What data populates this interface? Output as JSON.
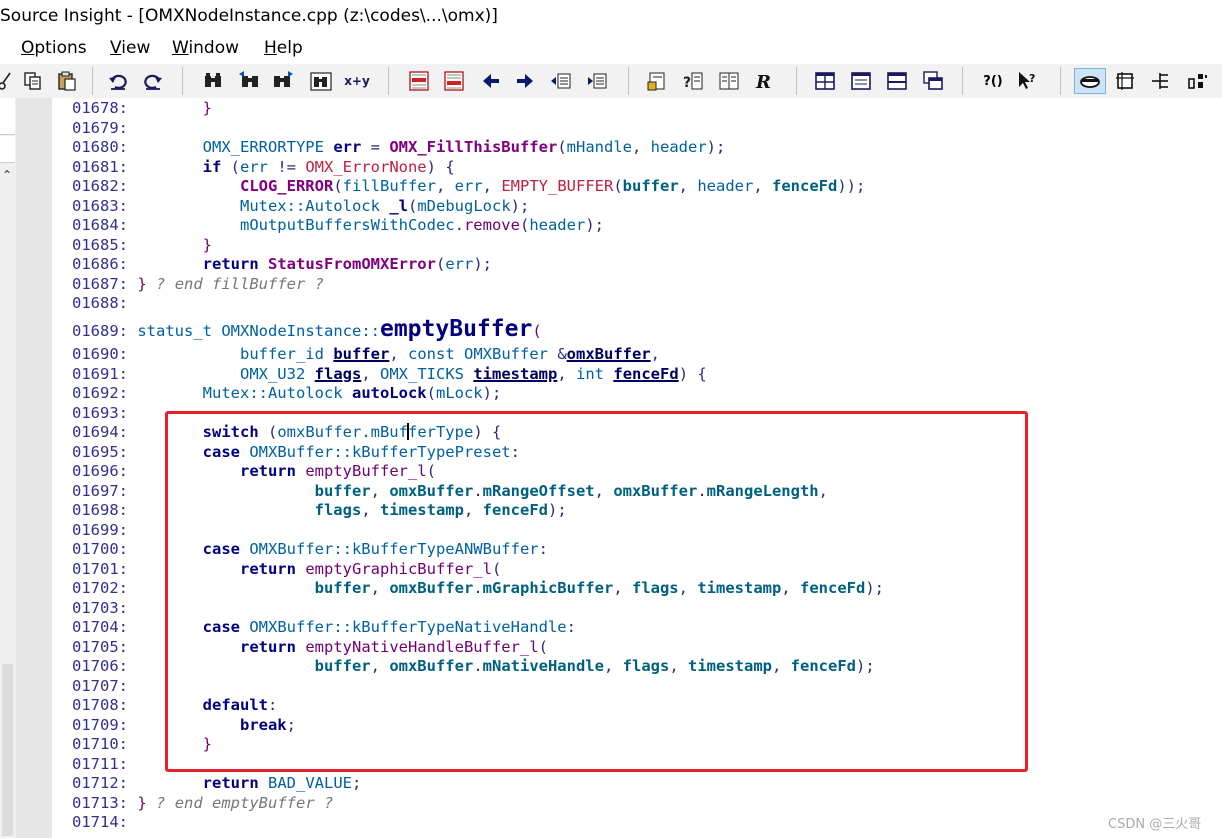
{
  "window": {
    "title": "Source Insight - [OMXNodeInstance.cpp (z:\\codes\\...\\omx)]"
  },
  "menu": [
    {
      "label": "Options",
      "u": "O",
      "rest": "ptions"
    },
    {
      "label": "View",
      "u": "V",
      "rest": "iew"
    },
    {
      "label": "Window",
      "u": "W",
      "rest": "indow"
    },
    {
      "label": "Help",
      "u": "H",
      "rest": "elp"
    }
  ],
  "toolbar": {
    "icons": [
      "cut-icon",
      "copy-icon",
      "paste-icon",
      "undo-icon",
      "redo-icon",
      "find-icon",
      "find-prev-icon",
      "find-next-icon",
      "search-files-icon",
      "replace-icon",
      "bookmark-prev-icon",
      "bookmark-next-icon",
      "back-icon",
      "forward-icon",
      "indent-right-icon",
      "indent-left-icon",
      "lookup-symbol-icon",
      "symbol-info-icon",
      "browse-book-icon",
      "relation-icon",
      "window-tile-icon",
      "window-list-icon",
      "window-split-icon",
      "window-cascade-icon",
      "context-help-icon",
      "pointer-help-icon",
      "toggle-view-icon",
      "layout-icon",
      "tree-icon",
      "grid-icon"
    ],
    "replace_label": "x+y",
    "help_label": "?()"
  },
  "code": {
    "lines": [
      {
        "n": "01678:",
        "html": "        }"
      },
      {
        "n": "01679:",
        "html": ""
      },
      {
        "n": "01680:",
        "html": "        OMX_ERRORTYPE err = OMX_FillThisBuffer(mHandle, header);"
      },
      {
        "n": "01681:",
        "html": "        if (err != OMX_ErrorNone) {"
      },
      {
        "n": "01682:",
        "html": "            CLOG_ERROR(fillBuffer, err, EMPTY_BUFFER(buffer, header, fenceFd));"
      },
      {
        "n": "01683:",
        "html": "            Mutex::Autolock _l(mDebugLock);"
      },
      {
        "n": "01684:",
        "html": "            mOutputBuffersWithCodec.remove(header);"
      },
      {
        "n": "01685:",
        "html": "        }"
      },
      {
        "n": "01686:",
        "html": "        return StatusFromOMXError(err);"
      },
      {
        "n": "01687:",
        "html": "} ? end fillBuffer ?"
      },
      {
        "n": "01688:",
        "html": ""
      },
      {
        "n": "01689:",
        "html": "status_t OMXNodeInstance::emptyBuffer("
      },
      {
        "n": "01690:",
        "html": "            buffer_id buffer, const OMXBuffer &omxBuffer,"
      },
      {
        "n": "01691:",
        "html": "            OMX_U32 flags, OMX_TICKS timestamp, int fenceFd) {"
      },
      {
        "n": "01692:",
        "html": "        Mutex::Autolock autoLock(mLock);"
      },
      {
        "n": "01693:",
        "html": ""
      },
      {
        "n": "01694:",
        "html": "        switch (omxBuffer.mBufferType) {"
      },
      {
        "n": "01695:",
        "html": "        case OMXBuffer::kBufferTypePreset:"
      },
      {
        "n": "01696:",
        "html": "            return emptyBuffer_l("
      },
      {
        "n": "01697:",
        "html": "                    buffer, omxBuffer.mRangeOffset, omxBuffer.mRangeLength,"
      },
      {
        "n": "01698:",
        "html": "                    flags, timestamp, fenceFd);"
      },
      {
        "n": "01699:",
        "html": ""
      },
      {
        "n": "01700:",
        "html": "        case OMXBuffer::kBufferTypeANWBuffer:"
      },
      {
        "n": "01701:",
        "html": "            return emptyGraphicBuffer_l("
      },
      {
        "n": "01702:",
        "html": "                    buffer, omxBuffer.mGraphicBuffer, flags, timestamp, fenceFd);"
      },
      {
        "n": "01703:",
        "html": ""
      },
      {
        "n": "01704:",
        "html": "        case OMXBuffer::kBufferTypeNativeHandle:"
      },
      {
        "n": "01705:",
        "html": "            return emptyNativeHandleBuffer_l("
      },
      {
        "n": "01706:",
        "html": "                    buffer, omxBuffer.mNativeHandle, flags, timestamp, fenceFd);"
      },
      {
        "n": "01707:",
        "html": ""
      },
      {
        "n": "01708:",
        "html": "        default:"
      },
      {
        "n": "01709:",
        "html": "            break;"
      },
      {
        "n": "01710:",
        "html": "        }"
      },
      {
        "n": "01711:",
        "html": ""
      },
      {
        "n": "01712:",
        "html": "        return BAD_VALUE;"
      },
      {
        "n": "01713:",
        "html": "} ? end emptyBuffer ?"
      },
      {
        "n": "01714:",
        "html": ""
      }
    ]
  },
  "watermark": "CSDN @三火哥",
  "colors": {
    "highlight_box": "#e8202a",
    "gutter": "#e6e6e6",
    "toolbar": "#f2f2f2"
  }
}
